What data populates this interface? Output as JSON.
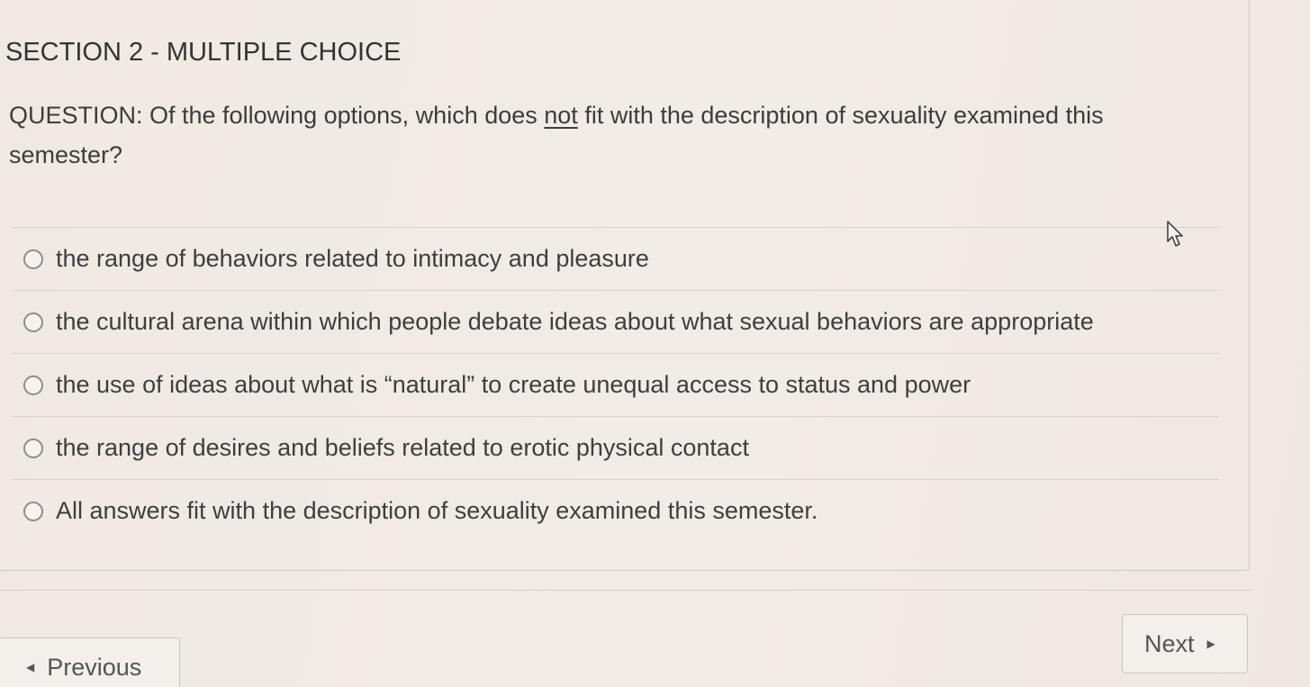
{
  "section": {
    "title": "SECTION 2 - MULTIPLE CHOICE"
  },
  "question": {
    "prefix": "QUESTION:  Of the following options, which does ",
    "emphasis": "not",
    "suffix": " fit with the description of sexuality examined this semester?"
  },
  "options": [
    {
      "label": "the range of behaviors related to intimacy and pleasure"
    },
    {
      "label": "the cultural arena within which people debate ideas about what sexual behaviors are appropriate"
    },
    {
      "label": "the use of ideas about what is “natural” to create unequal access to status and power"
    },
    {
      "label": "the range of desires and beliefs related to erotic physical contact"
    },
    {
      "label": "All answers fit with the description of sexuality examined this semester."
    }
  ],
  "nav": {
    "previous_label": "Previous",
    "next_label": "Next"
  },
  "icons": {
    "previous": "triangle-left-icon",
    "next": "triangle-right-icon",
    "cursor": "mouse-pointer-icon",
    "option": "radio-circle-icon"
  }
}
